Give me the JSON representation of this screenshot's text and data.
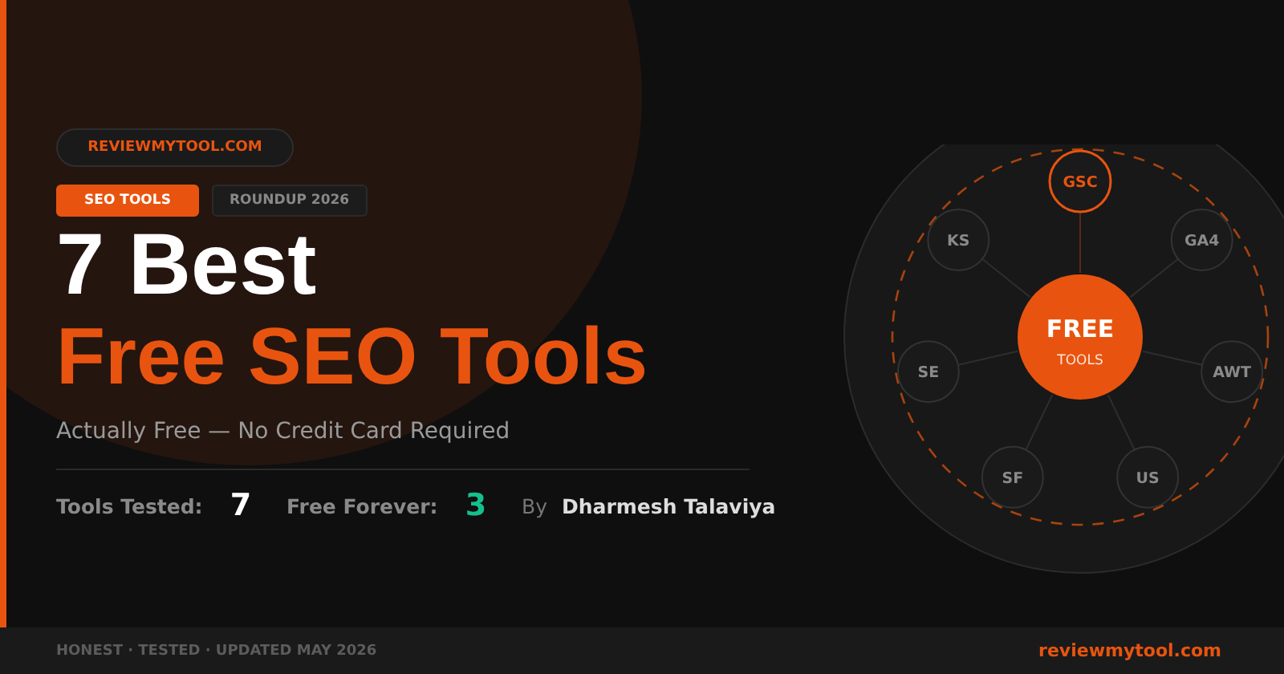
{
  "site_pill": "REVIEWMYTOOL.COM",
  "tags": [
    {
      "label": "SEO TOOLS",
      "selected": true
    },
    {
      "label": "ROUNDUP 2026",
      "selected": false
    }
  ],
  "title_line_1": "7 Best",
  "title_line_2": "Free SEO Tools",
  "subtitle": "Actually Free — No Credit Card Required",
  "stats": [
    {
      "label": "Tools Tested:",
      "value": "7",
      "kind": "count"
    },
    {
      "label": "Free Forever:",
      "value": "3",
      "kind": "free"
    }
  ],
  "byline": {
    "prefix": "By",
    "author": "Dharmesh Talaviya"
  },
  "diagram": {
    "center_title": "FREE",
    "center_subtitle": "TOOLS",
    "nodes": [
      {
        "label": "GSC",
        "highlighted": true
      },
      {
        "label": "GA4",
        "highlighted": false
      },
      {
        "label": "AWT",
        "highlighted": false
      },
      {
        "label": "US",
        "highlighted": false
      },
      {
        "label": "SF",
        "highlighted": false
      },
      {
        "label": "SE",
        "highlighted": false
      },
      {
        "label": "KS",
        "highlighted": false
      }
    ]
  },
  "footer": {
    "tagline": "HONEST · TESTED · UPDATED MAY 2026",
    "site": "reviewmytool.com"
  }
}
